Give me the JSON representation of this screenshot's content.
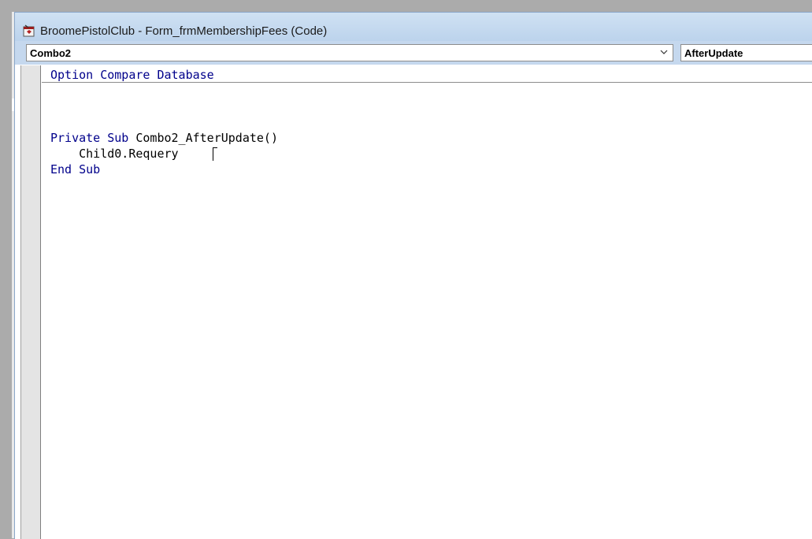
{
  "window": {
    "title": "BroomePistolClub - Form_frmMembershipFees (Code)"
  },
  "toolbar": {
    "object_combo_value": "Combo2",
    "procedure_combo_value": "AfterUpdate"
  },
  "code": {
    "line1": {
      "kw1": "Option Compare Database"
    },
    "line2": {
      "kw1": "Private Sub",
      "rest": " Combo2_AfterUpdate()"
    },
    "line3": {
      "text": "    Child0.Requery"
    },
    "line4": {
      "kw1": "End Sub"
    }
  },
  "colors": {
    "keyword": "#00008b",
    "title_bar": "#c5d8ee",
    "margin": "#e4e4e4"
  },
  "icons": {
    "window_icon": "vba-module-icon",
    "dropdown": "chevron-down-icon"
  }
}
